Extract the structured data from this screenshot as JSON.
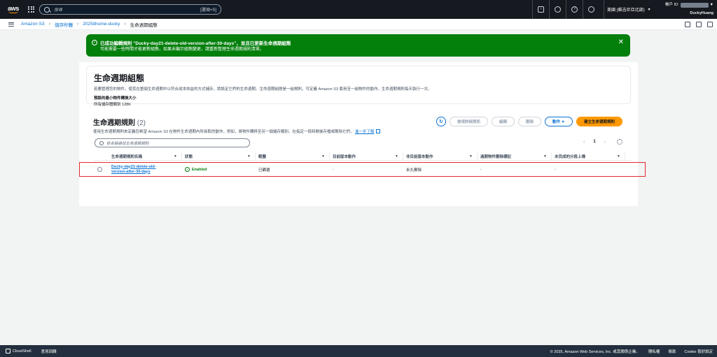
{
  "topnav": {
    "logo": "aws",
    "search_placeholder": "搜尋",
    "search_shortcut": "[選項+S]",
    "icons": [
      "cloudshell-icon",
      "bell-icon",
      "help-icon",
      "gear-icon"
    ],
    "region": "美國 (維吉尼亞北部)",
    "account_label": "帳戶 ID:",
    "user": "DuckyHuang"
  },
  "breadcrumb": {
    "items": [
      "Amazon S3",
      "儲存貯體",
      "2025ithome-ducky"
    ],
    "current": "生命週期組態"
  },
  "flash": {
    "title": "已成功編輯規則 \"Ducky-day21-delete-old-version-after-30-days\"，並且已更新生命週期組態",
    "message": "可能需要一些時間才能更新組態，如果未顯示組態變更，請重新整理生命週期規則清單。",
    "color": "#037f0c"
  },
  "config": {
    "title": "生命週期組態",
    "description": "若要管理您的物件，使其在整個生命週期中以符合成本效益的方式儲存，請設定它們的生命週期。生命週期組態是一組規則，可定義 Amazon S3 套用至一組物件的動作。生命週期規則每天執行一次。",
    "min_size_label": "預設的最小物件轉換大小",
    "min_size_value": "所有儲存體類別 128K"
  },
  "rules": {
    "title": "生命週期規則",
    "count": "(2)",
    "description": "使用生命週期規則來定義您希望 Amazon S3 在物件生命週期內所採取的動作，例如，將物件轉移至另一個儲存類別、在指定一段時間後存檔或刪除它們，",
    "learn_more": "進一步了解",
    "buttons": {
      "refresh": "↻",
      "view_details": "檢視詳細資訊",
      "edit": "編輯",
      "delete": "刪除",
      "actions": "動作 ▼",
      "create": "建立生命週期規則"
    },
    "filter_placeholder": "依名稱尋找生命週期規則",
    "pager": {
      "prev": "‹",
      "page": "1",
      "next": "›"
    },
    "columns": [
      "生命週期規則名稱",
      "狀態",
      "範圍",
      "目前版本動作",
      "非目前版本動作",
      "過期物件刪除標記",
      "未完成的分段上傳"
    ],
    "rows": [
      {
        "name_line1": "Ducky-day21-delete-old-",
        "name_line2": "version-after-30-days",
        "status": "Enabled",
        "scope": "已篩選",
        "current_action": "-",
        "noncurrent_action": "永久刪除",
        "expired_marker": "-",
        "multipart": "-"
      }
    ]
  },
  "footer": {
    "cloudshell": "CloudShell",
    "feedback": "意見回饋",
    "copyright": "© 2025, Amazon Web Services, Inc. 或其關係企業。",
    "privacy": "隱私權",
    "terms": "條款",
    "cookies": "Cookie 喜好設定"
  }
}
